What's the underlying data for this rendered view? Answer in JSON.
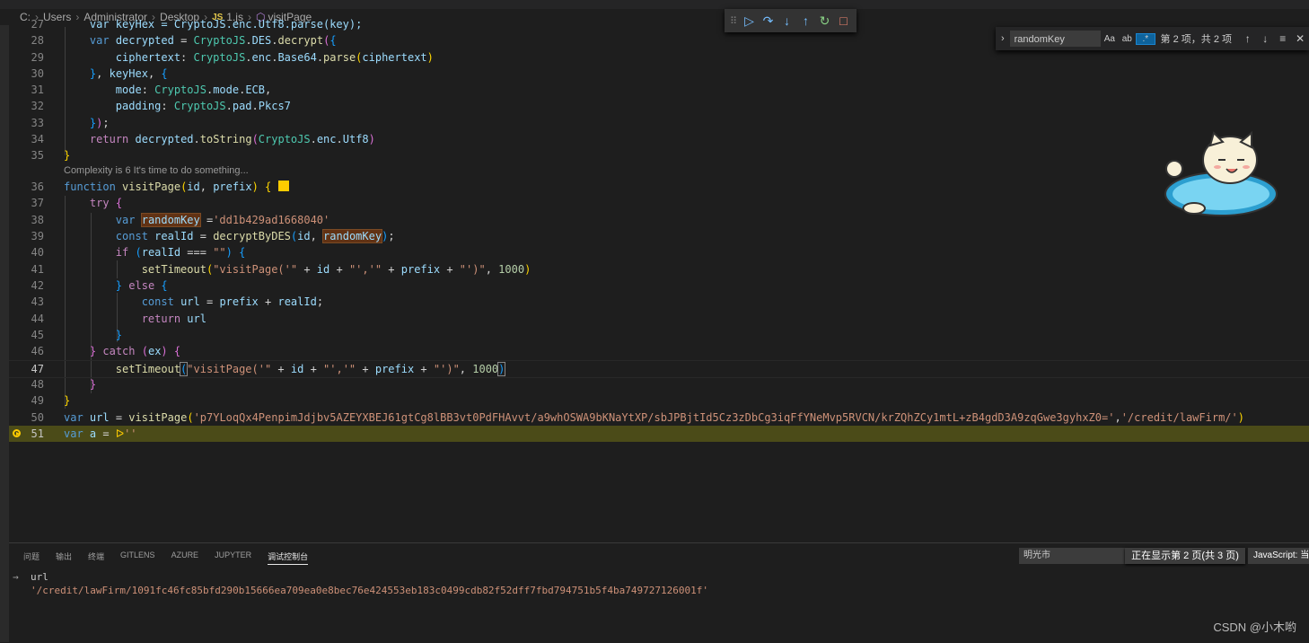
{
  "breadcrumb": {
    "items": [
      "C:",
      "Users",
      "Administrator",
      "Desktop",
      "1.js",
      "visitPage"
    ],
    "file_icon": "JS"
  },
  "find_widget": {
    "query": "randomKey",
    "match_case": "Aa",
    "whole_word": "ab",
    "regex": ".*",
    "result": "第 2 项，共 2 项"
  },
  "debug_toolbar": {
    "buttons": [
      "drag-handle",
      "continue",
      "step-over",
      "step-into",
      "step-out",
      "restart",
      "stop"
    ]
  },
  "editor": {
    "codelens": "Complexity is 6 It's time to do something...",
    "line_numbers": [
      "27",
      "28",
      "29",
      "30",
      "31",
      "32",
      "33",
      "34",
      "35",
      "36",
      "37",
      "38",
      "39",
      "40",
      "41",
      "42",
      "43",
      "44",
      "45",
      "46",
      "47",
      "48",
      "49",
      "50",
      "51"
    ],
    "lines": {
      "l27": "    var keyHex = CryptoJS.enc.Utf8.parse(key);",
      "l28a": "var",
      "l28b": "decrypted",
      "l28c": "CryptoJS",
      "l28d": "DES",
      "l28e": "decrypt",
      "l29a": "ciphertext",
      "l29b": "CryptoJS",
      "l29c": "enc",
      "l29d": "Base64",
      "l29e": "parse",
      "l29f": "ciphertext",
      "l30": "keyHex",
      "l31a": "mode",
      "l31b": "CryptoJS",
      "l31c": "mode",
      "l31d": "ECB",
      "l32a": "padding",
      "l32b": "CryptoJS",
      "l32c": "pad",
      "l32d": "Pkcs7",
      "l34a": "return",
      "l34b": "decrypted",
      "l34c": "toString",
      "l34d": "CryptoJS",
      "l34e": "enc",
      "l34f": "Utf8",
      "l36a": "function",
      "l36b": "visitPage",
      "l36c": "id",
      "l36d": "prefix",
      "l37": "try",
      "l38a": "var",
      "l38b": "randomKey",
      "l38c": "'dd1b429ad1668040'",
      "l39a": "const",
      "l39b": "realId",
      "l39c": "decryptByDES",
      "l39d": "id",
      "l39e": "randomKey",
      "l40a": "if",
      "l40b": "realId",
      "l40c": "\"\"",
      "l41a": "setTimeout",
      "l41b": "\"visitPage('\"",
      "l41c": "id",
      "l41d": "\"','\"",
      "l41e": "prefix",
      "l41f": "\"')\"",
      "l41g": "1000",
      "l42a": "else",
      "l43a": "const",
      "l43b": "url",
      "l43c": "prefix",
      "l43d": "realId",
      "l44a": "return",
      "l44b": "url",
      "l46a": "catch",
      "l46b": "ex",
      "l47a": "setTimeout",
      "l47b": "\"visitPage('\"",
      "l47c": "id",
      "l47d": "\"','\"",
      "l47e": "prefix",
      "l47f": "\"')\"",
      "l47g": "1000",
      "l50a": "var",
      "l50b": "url",
      "l50c": "visitPage",
      "l50d": "'p7YLoqQx4PenpimJdjbv5AZEYXBEJ61gtCg8lBB3vt0PdFHAvvt/a9whOSWA9bKNaYtXP/sbJPBjtId5Cz3zDbCg3iqFfYNeMvp5RVCN/krZQhZCy1mtL+zB4gdD3A9zqGwe3gyhxZ0='",
      "l50e": "'/credit/lawFirm/'",
      "l51a": "var",
      "l51b": "a",
      "l51c": "''"
    }
  },
  "panel": {
    "tabs": [
      "问题",
      "输出",
      "终端",
      "GITLENS",
      "AZURE",
      "JUPYTER",
      "调试控制台"
    ],
    "active_tab": "调试控制台",
    "filter_text": "明光市",
    "page_info": "正在显示第 2 页(共 3 页)",
    "language": "JavaScript: 当",
    "console": {
      "label": "url",
      "value": "'/credit/lawFirm/1091fc46fc85bfd290b15666ea709ea0e8bec76e424553eb183c0499cdb82f52dff7fbd794751b5f4ba749727126001f'"
    }
  },
  "watermark": "CSDN @小木哟",
  "colors": {
    "background": "#1e1e1e",
    "current_line": "#4b4b18",
    "breakpoint": "#ffcc00",
    "search_highlight": "#613214",
    "string": "#ce9178",
    "keyword": "#569cd6"
  }
}
